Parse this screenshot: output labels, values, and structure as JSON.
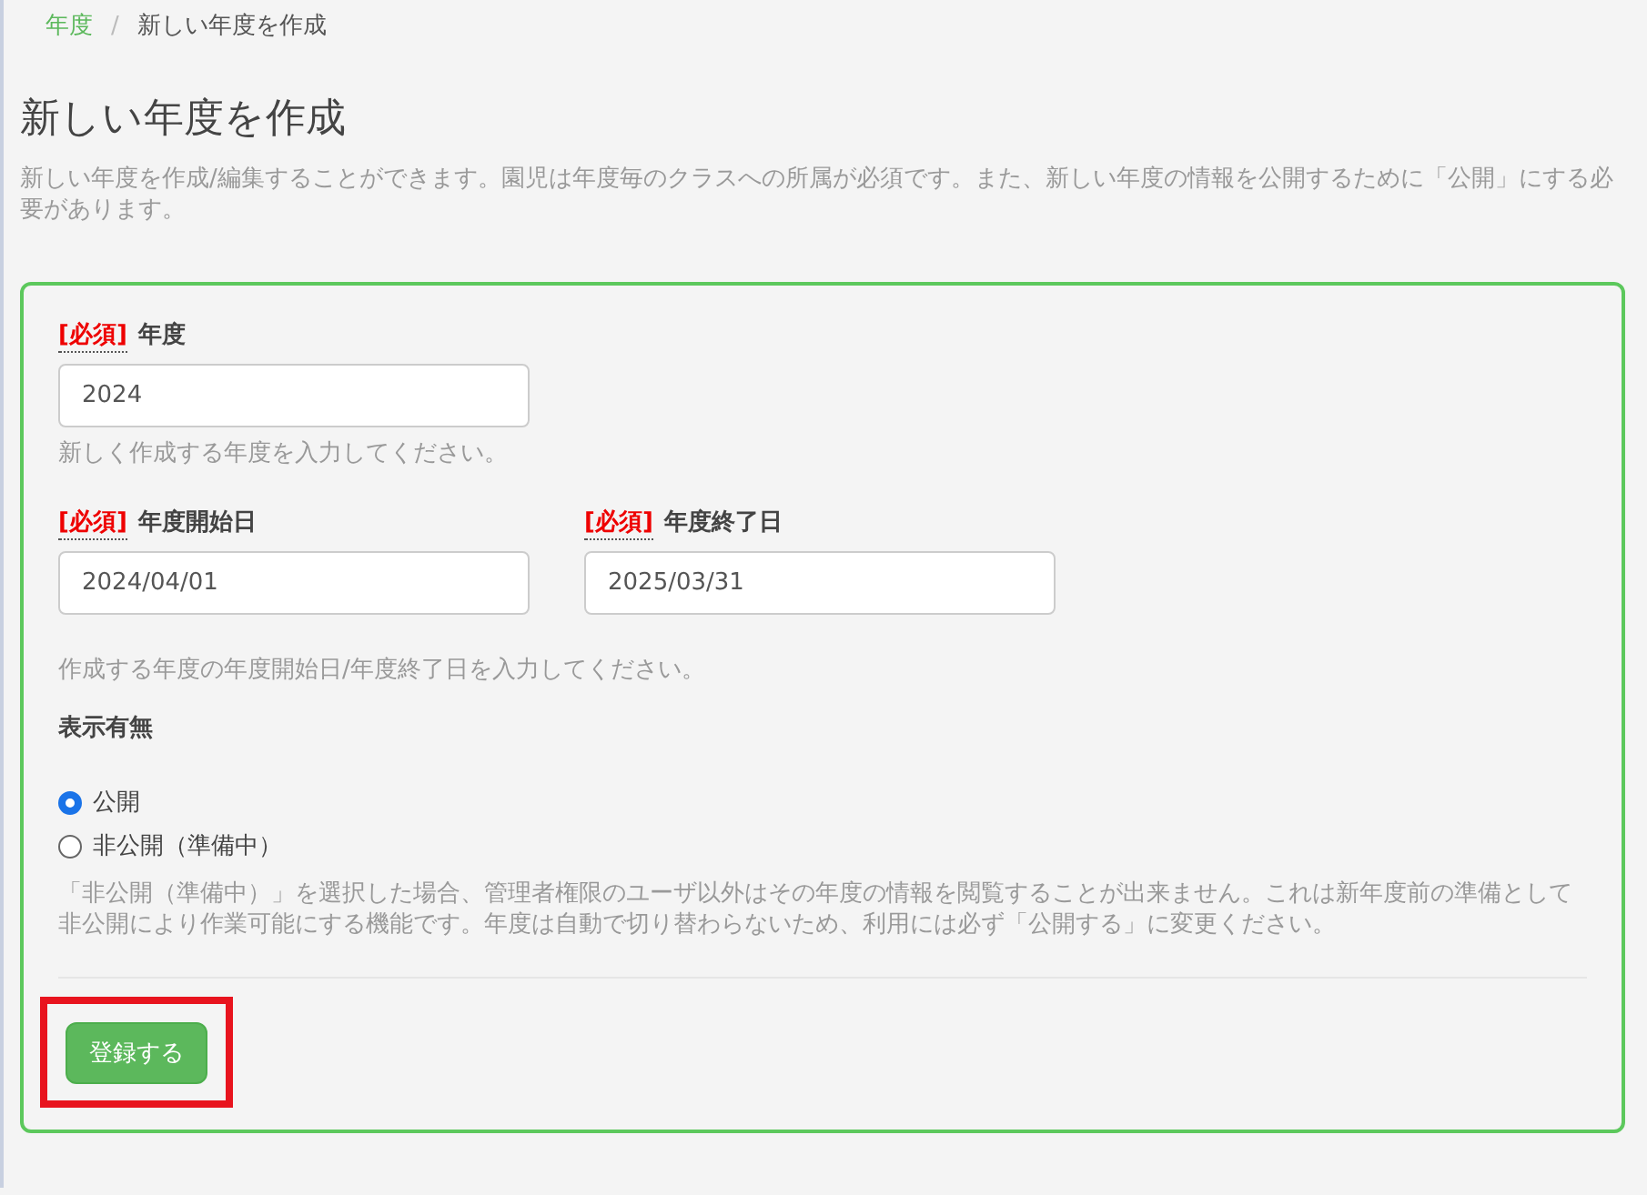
{
  "breadcrumb": [
    {
      "label": "年度",
      "link": true
    },
    {
      "label": "新しい年度を作成",
      "link": false
    }
  ],
  "breadcrumb_separator": "/",
  "title": "新しい年度を作成",
  "description": "新しい年度を作成/編集することができます。園児は年度毎のクラスへの所属が必須です。また、新しい年度の情報を公開するために「公開」にする必要があります。",
  "form": {
    "year": {
      "required_mark": "[必須]",
      "label": "年度",
      "value": "2024",
      "help": "新しく作成する年度を入力してください。"
    },
    "dates": [
      {
        "required_mark": "[必須]",
        "label": "年度開始日",
        "value": "2024/04/01"
      },
      {
        "required_mark": "[必須]",
        "label": "年度終了日",
        "value": "2025/03/31"
      }
    ],
    "dates_help": "作成する年度の年度開始日/年度終了日を入力してください。",
    "visibility": {
      "label": "表示有無",
      "options": [
        {
          "label": "公開",
          "selected": true
        },
        {
          "label": "非公開（準備中）",
          "selected": false
        }
      ],
      "help": "「非公開（準備中）」を選択した場合、管理者権限のユーザ以外はその年度の情報を閲覧することが出来ません。これは新年度前の準備として非公開により作業可能にする機能です。年度は自動で切り替わらないため、利用には必ず「公開する」に変更ください。"
    },
    "submit": {
      "label": "登録する",
      "highlighted": true
    }
  }
}
